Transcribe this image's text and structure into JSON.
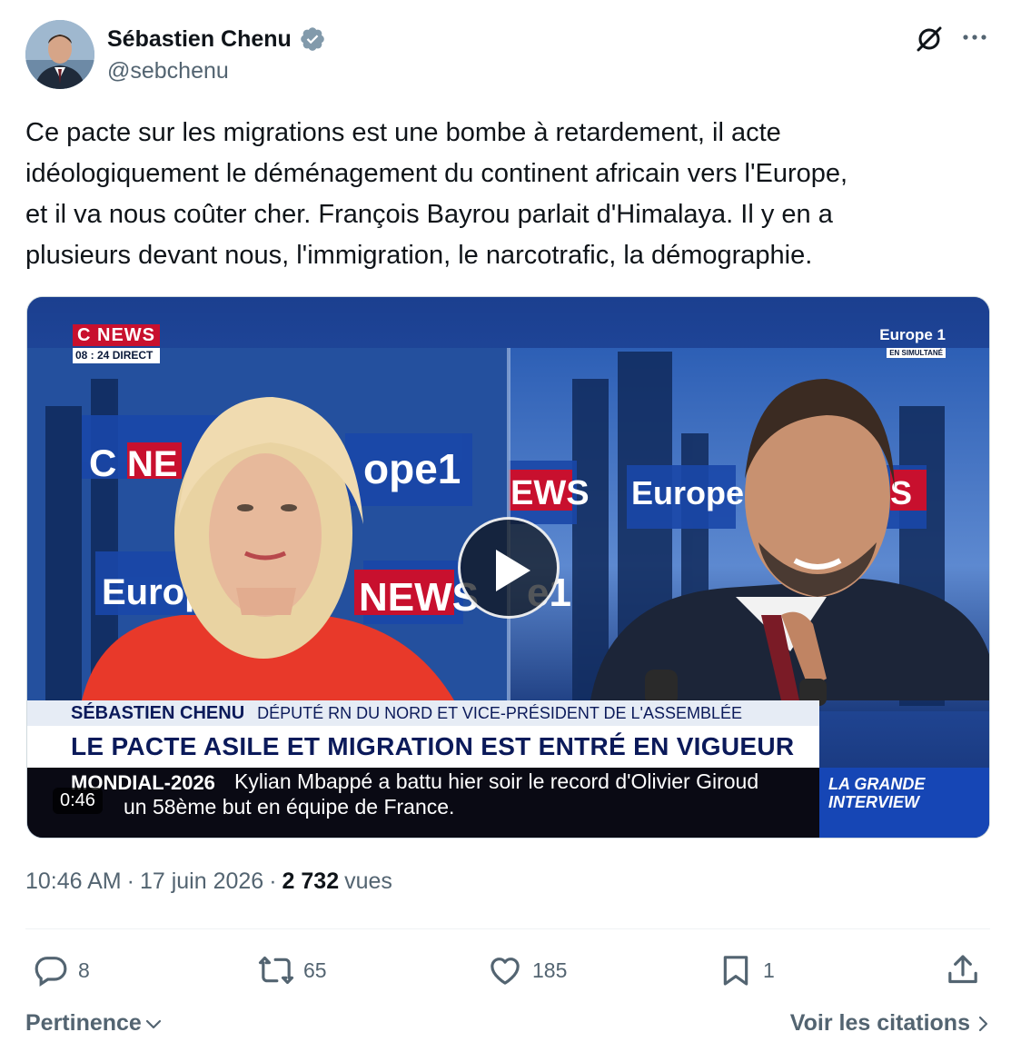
{
  "author": {
    "display_name": "Sébastien Chenu",
    "handle": "@sebchenu",
    "verified": true
  },
  "tweet": {
    "text": "Ce pacte sur les migrations est une bombe à retardement, il acte\nidéologiquement le déménagement du continent africain vers l'Europe,\net il va nous coûter cher. François Bayrou parlait d'Himalaya. Il y en a\nplusieurs devant nous, l'immigration, le narcotrafic, la démographie."
  },
  "video": {
    "duration": "0:46",
    "progress_fraction": 0,
    "channel_logo": "C NEWS",
    "time_badge": "08 : 24 DIRECT",
    "partner_logo": "Europe 1",
    "partner_sub": "EN SIMULTANÉ",
    "lower_third_name": "SÉBASTIEN CHENU",
    "lower_third_role": "DÉPUTÉ RN DU NORD ET VICE-PRÉSIDENT DE L'ASSEMBLÉE",
    "headline": "LE PACTE ASILE ET MIGRATION EST ENTRÉ EN VIGUEUR",
    "ticker_tag": "MONDIAL-2026",
    "ticker_line1": "Kylian Mbappé a battu hier soir le record d'Olivier Giroud",
    "ticker_line2": "un 58ème but en équipe de France.",
    "show_name": "LA GRANDE INTERVIEW"
  },
  "meta": {
    "time": "10:46 AM",
    "separator": "·",
    "date": "17 juin 2026",
    "views_count": "2 732",
    "views_label": "vues"
  },
  "actions": {
    "replies": "8",
    "reposts": "65",
    "likes": "185",
    "bookmarks": "1"
  },
  "footer": {
    "sort_label": "Pertinence",
    "quotes_link": "Voir les citations"
  },
  "colors": {
    "text_primary": "#0f1419",
    "text_secondary": "#536471",
    "verified_badge": "#829aab",
    "cnews_red": "#c8102e",
    "ticker_blue": "#1646b5"
  },
  "icons": {
    "grok": "grok-icon",
    "more": "more-icon",
    "reply": "reply-icon",
    "repost": "repost-icon",
    "like": "heart-icon",
    "bookmark": "bookmark-icon",
    "share": "share-icon"
  }
}
